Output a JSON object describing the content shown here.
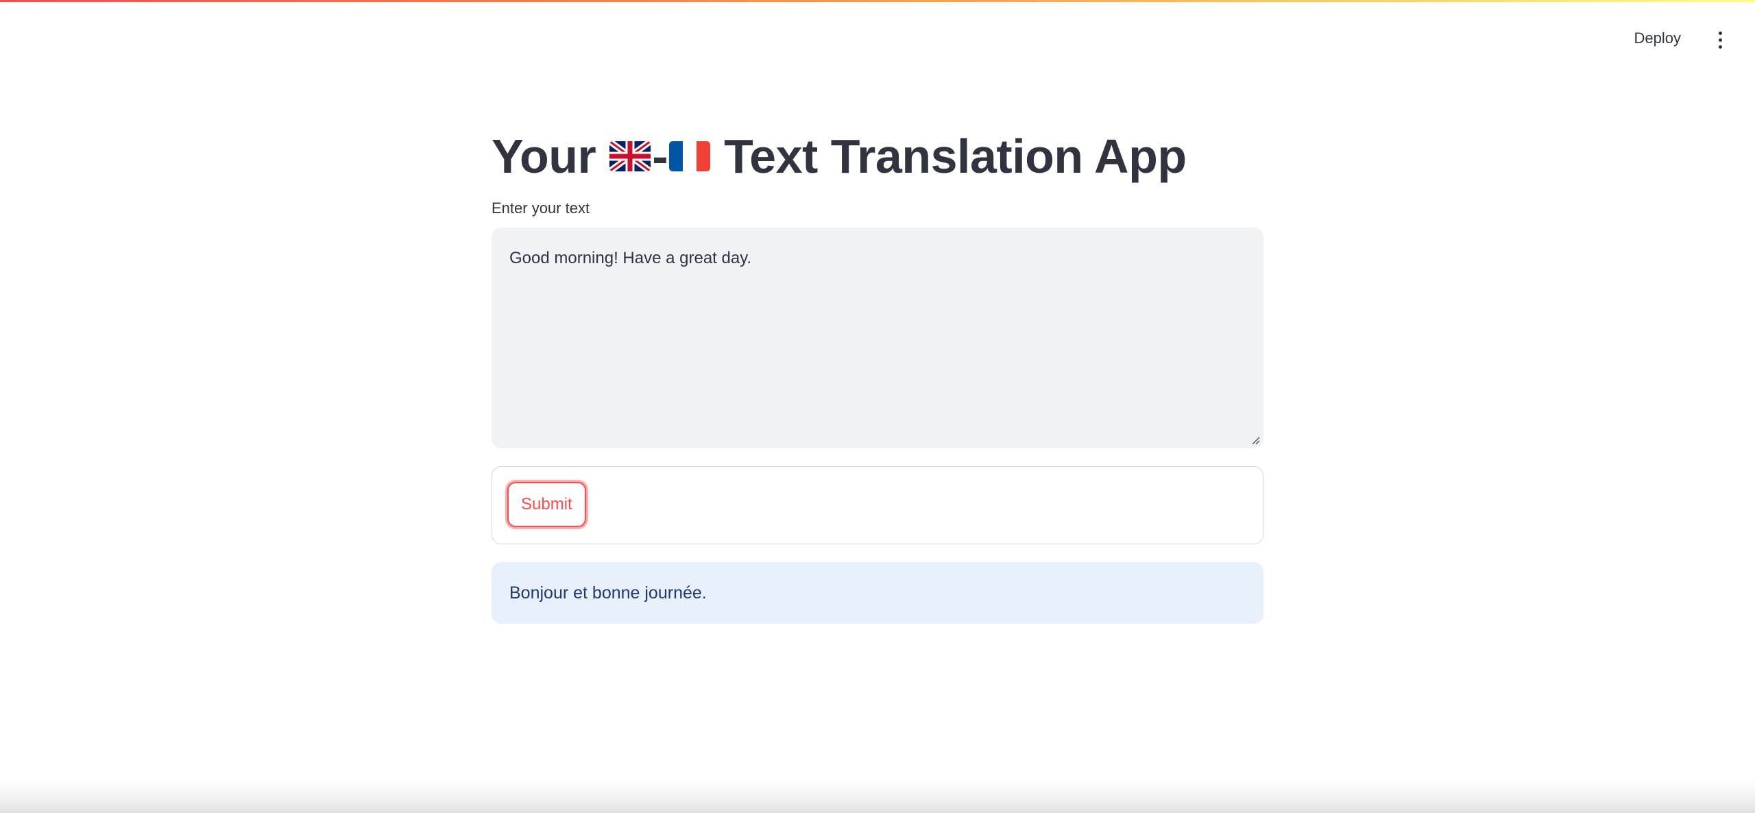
{
  "header": {
    "deploy_label": "Deploy",
    "menu_icon": "more-vertical-icon"
  },
  "main": {
    "title_prefix": "Your",
    "title_separator": "-",
    "title_suffix": "Text Translation App",
    "flags": [
      "uk-flag-icon",
      "france-flag-icon"
    ],
    "input_label": "Enter your text",
    "input_value": "Good morning! Have a great day.",
    "submit_label": "Submit",
    "result_text": "Bonjour et bonne journée."
  },
  "colors": {
    "accent": "#ff4b4b",
    "textarea_bg": "#f0f2f6",
    "result_bg": "#e8f0fb",
    "result_text": "#1e3a6e",
    "text": "#31333f"
  }
}
